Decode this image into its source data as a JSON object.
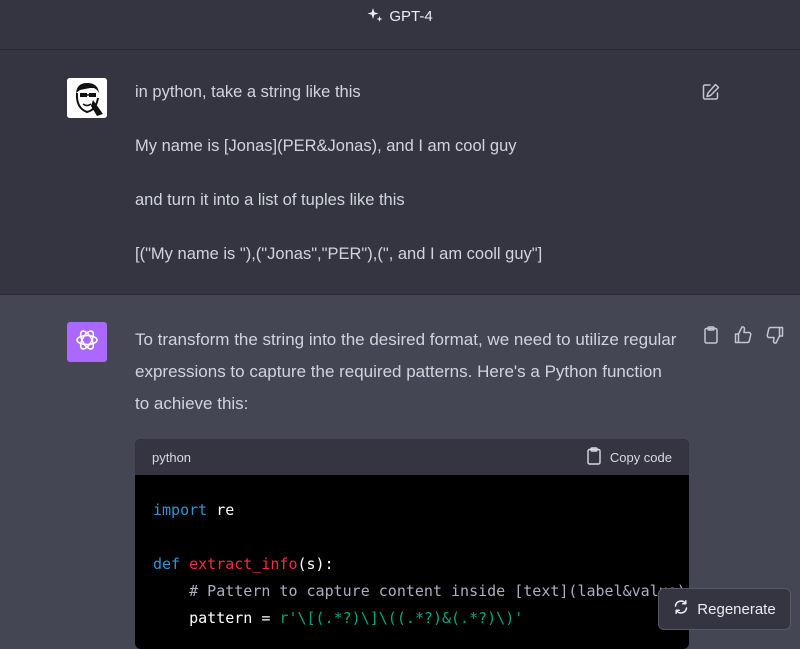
{
  "header": {
    "model_name": "GPT-4",
    "model_icon": "sparkle-icon"
  },
  "user_message": {
    "paragraphs": [
      "in python, take a string like this",
      "My name is [Jonas](PER&Jonas), and I am cool guy",
      "and turn it into a  list of tuples like this",
      "[(\"My name is \"),(\"Jonas\",\"PER\"),(\", and I am cooll guy\"]"
    ],
    "edit_icon": "edit-icon"
  },
  "assistant_message": {
    "text": "To transform the string into the desired format, we need to utilize regular expressions to capture the required patterns. Here's a Python function to achieve this:",
    "icons": [
      "clipboard-icon",
      "thumbs-up-icon",
      "thumbs-down-icon"
    ],
    "code_block": {
      "language": "python",
      "copy_label": "Copy code",
      "lines": {
        "l1_kw": "import",
        "l1_rest": " re",
        "l3_kw": "def",
        "l3_fn": "extract_info",
        "l3_rest": "(s):",
        "l4_comment": "    # Pattern to capture content inside [text](label&value)",
        "l5_lead": "    pattern = ",
        "l5_str": "r'\\[(.*?)\\]\\((.*?)&(.*?)\\)'"
      }
    }
  },
  "regenerate": {
    "label": "Regenerate",
    "icon": "refresh-icon"
  },
  "colors": {
    "gpt_avatar": "#ab68ff",
    "keyword": "#2e95d3",
    "function": "#f22c3d",
    "string": "#00a67d"
  }
}
